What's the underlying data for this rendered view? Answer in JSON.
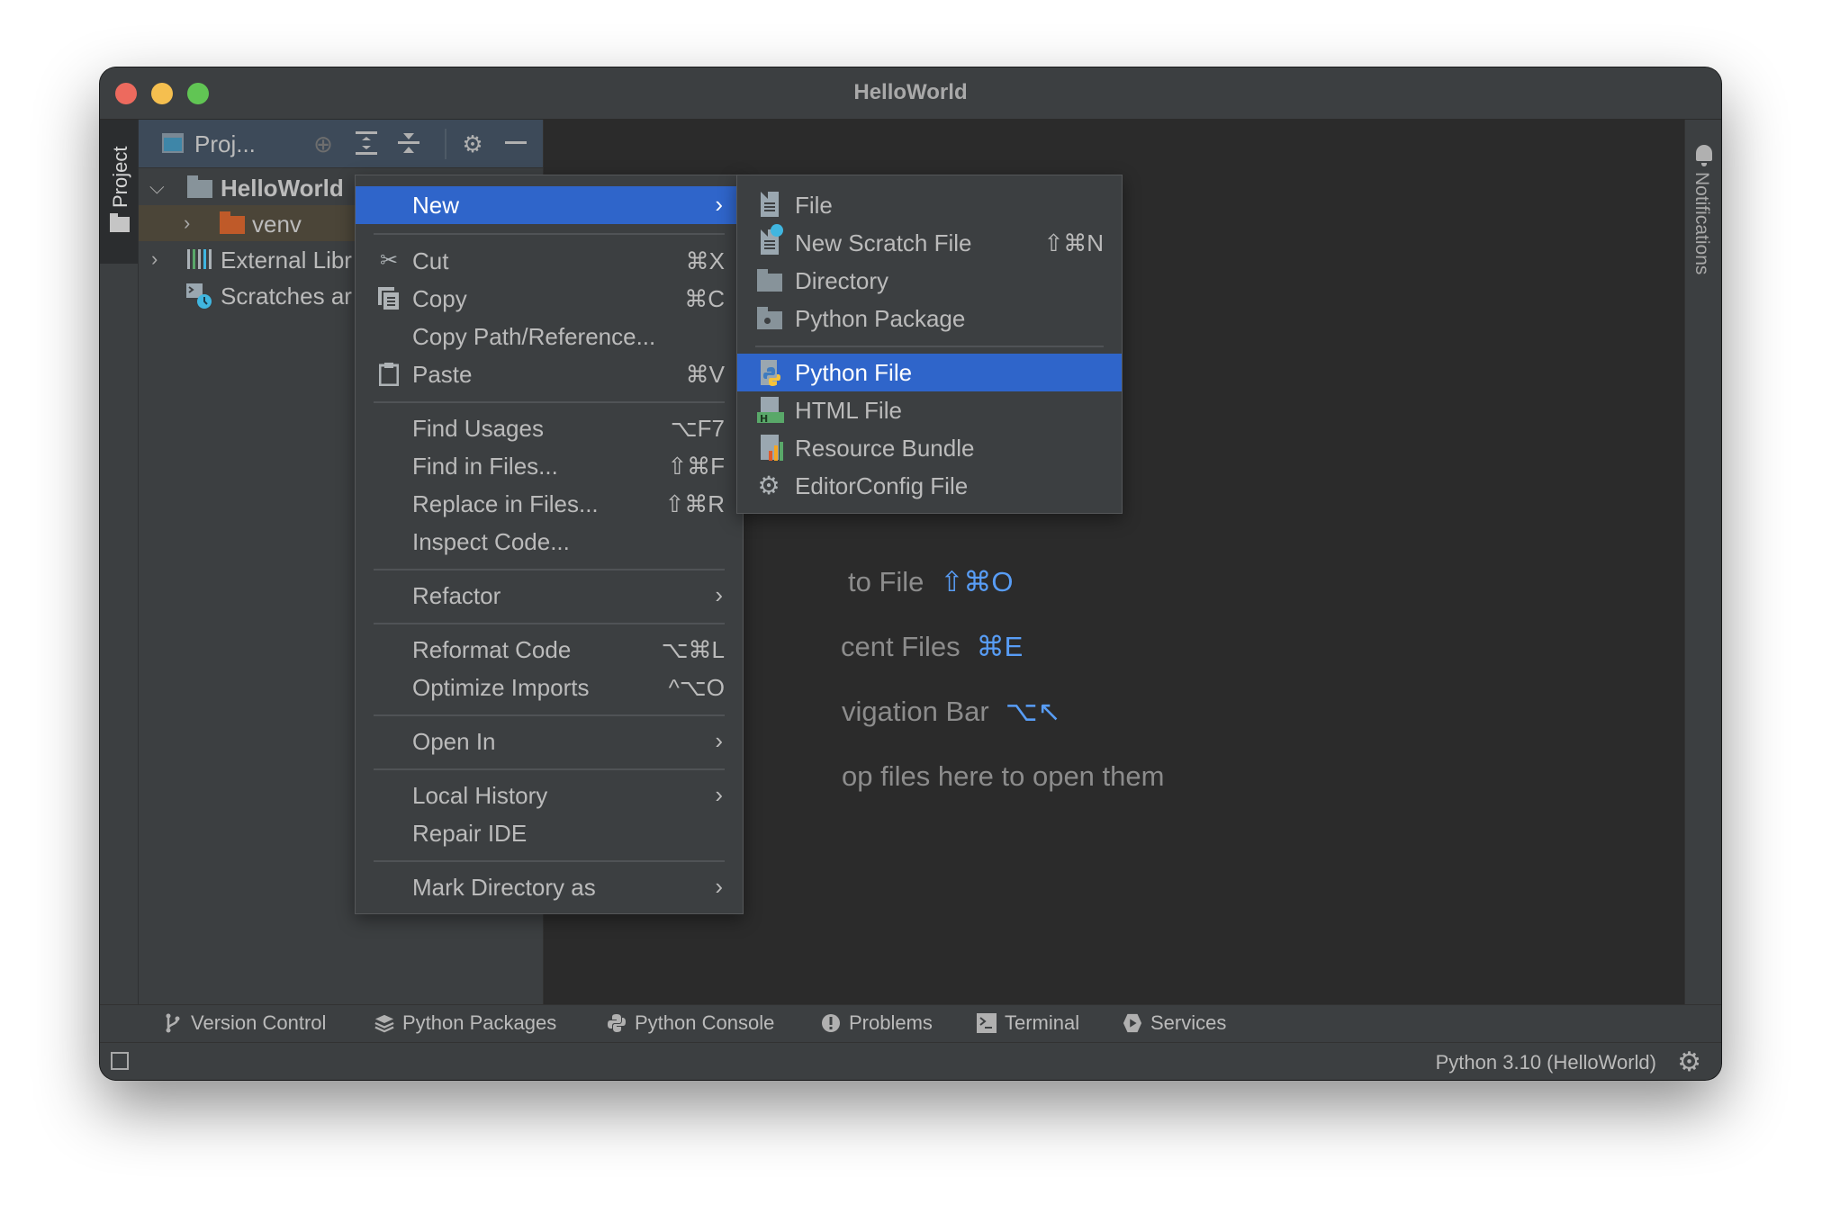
{
  "window": {
    "title": "HelloWorld",
    "traffic_lights": [
      "close",
      "minimize",
      "maximize"
    ]
  },
  "left_strip": {
    "tab_label": "Project",
    "tab_icon": "folder-icon"
  },
  "project_panel": {
    "title": "Proj...",
    "header_icons": [
      "locate-icon",
      "expand-all-icon",
      "collapse-all-icon",
      "gear-icon",
      "hide-icon"
    ],
    "tree": [
      {
        "label": "HelloWorld",
        "icon": "folder-icon",
        "expanded": true,
        "bold": true,
        "indent": 0
      },
      {
        "label": "venv",
        "icon": "excluded-folder-icon",
        "expanded": false,
        "indent": 1,
        "selected": true
      },
      {
        "label": "External Libr",
        "icon": "libraries-icon",
        "expanded": false,
        "indent": 0
      },
      {
        "label": "Scratches ar",
        "icon": "scratches-icon",
        "indent": 0
      }
    ]
  },
  "editor": {
    "hints": [
      {
        "text": "to File",
        "shortcut": "⇧⌘O"
      },
      {
        "text": "cent Files",
        "shortcut": "⌘E"
      },
      {
        "text": "vigation Bar",
        "shortcut": "⌥↖"
      },
      {
        "text": "op files here to open them",
        "shortcut": ""
      }
    ]
  },
  "right_strip": {
    "label": "Notifications",
    "icon": "bell-icon"
  },
  "context_menu": {
    "items": [
      {
        "label": "New",
        "shortcut": "",
        "submenu": true,
        "highlighted": true,
        "icon": ""
      },
      {
        "separator": true
      },
      {
        "label": "Cut",
        "shortcut": "⌘X",
        "icon": "scissors-icon"
      },
      {
        "label": "Copy",
        "shortcut": "⌘C",
        "icon": "copy-icon"
      },
      {
        "label": "Copy Path/Reference...",
        "shortcut": "",
        "icon": ""
      },
      {
        "label": "Paste",
        "shortcut": "⌘V",
        "icon": "clipboard-icon"
      },
      {
        "separator": true
      },
      {
        "label": "Find Usages",
        "shortcut": "⌥F7"
      },
      {
        "label": "Find in Files...",
        "shortcut": "⇧⌘F"
      },
      {
        "label": "Replace in Files...",
        "shortcut": "⇧⌘R"
      },
      {
        "label": "Inspect Code...",
        "shortcut": ""
      },
      {
        "separator": true
      },
      {
        "label": "Refactor",
        "submenu": true
      },
      {
        "separator": true
      },
      {
        "label": "Reformat Code",
        "shortcut": "⌥⌘L"
      },
      {
        "label": "Optimize Imports",
        "shortcut": "^⌥O"
      },
      {
        "separator": true
      },
      {
        "label": "Open In",
        "submenu": true
      },
      {
        "separator": true
      },
      {
        "label": "Local History",
        "submenu": true
      },
      {
        "label": "Repair IDE",
        "shortcut": ""
      },
      {
        "separator": true
      },
      {
        "label": "Mark Directory as",
        "submenu": true
      }
    ]
  },
  "new_submenu": {
    "items": [
      {
        "label": "File",
        "shortcut": "",
        "icon": "file-icon"
      },
      {
        "label": "New Scratch File",
        "shortcut": "⇧⌘N",
        "icon": "scratch-file-icon"
      },
      {
        "label": "Directory",
        "shortcut": "",
        "icon": "folder-icon"
      },
      {
        "label": "Python Package",
        "shortcut": "",
        "icon": "package-icon"
      },
      {
        "separator": true
      },
      {
        "label": "Python File",
        "shortcut": "",
        "icon": "python-file-icon",
        "highlighted": true
      },
      {
        "label": "HTML File",
        "shortcut": "",
        "icon": "html-file-icon"
      },
      {
        "label": "Resource Bundle",
        "shortcut": "",
        "icon": "resource-bundle-icon"
      },
      {
        "label": "EditorConfig File",
        "shortcut": "",
        "icon": "gear-icon"
      }
    ]
  },
  "tool_window_bar": {
    "items": [
      {
        "label": "Version Control",
        "icon": "branch-icon"
      },
      {
        "label": "Python Packages",
        "icon": "layers-icon"
      },
      {
        "label": "Python Console",
        "icon": "python-icon"
      },
      {
        "label": "Problems",
        "icon": "warning-icon"
      },
      {
        "label": "Terminal",
        "icon": "terminal-icon"
      },
      {
        "label": "Services",
        "icon": "services-icon"
      }
    ]
  },
  "status_bar": {
    "interpreter": "Python 3.10 (HelloWorld)",
    "settings_icon": "gear-icon",
    "layout_icon": "window-layout-icon"
  },
  "colors": {
    "accent": "#2f65ca",
    "panel_bg": "#3c3f41",
    "editor_bg": "#2b2b2b",
    "header_bg": "#3d4a59",
    "selected_row": "#4b4538",
    "shortcut_blue": "#589df6",
    "excluded_folder": "#bf5a29"
  }
}
